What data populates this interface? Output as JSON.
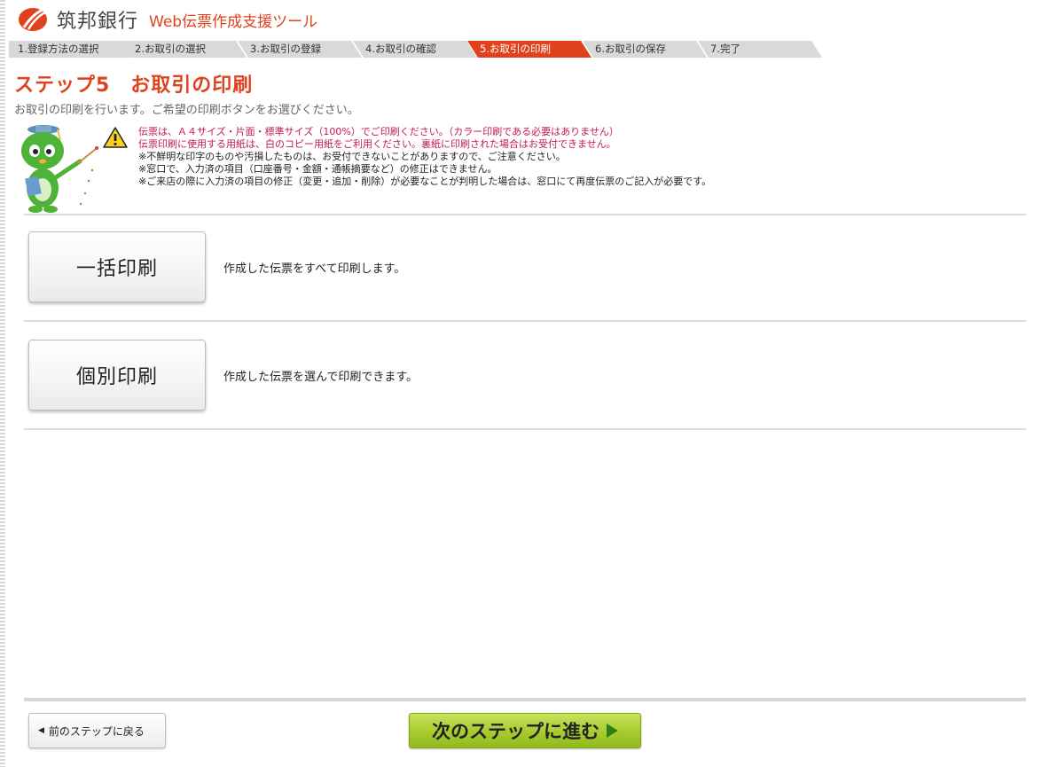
{
  "header": {
    "bank_name": "筑邦銀行",
    "tool_name": "Web伝票作成支援ツール",
    "brand_color": "#e0421d"
  },
  "steps": [
    {
      "label": "1.登録方法の選択",
      "active": false
    },
    {
      "label": "2.お取引の選択",
      "active": false
    },
    {
      "label": "3.お取引の登録",
      "active": false
    },
    {
      "label": "4.お取引の確認",
      "active": false
    },
    {
      "label": "5.お取引の印刷",
      "active": true
    },
    {
      "label": "6.お取引の保存",
      "active": false
    },
    {
      "label": "7.完了",
      "active": false
    }
  ],
  "page": {
    "title": "ステップ5　お取引の印刷",
    "subtitle": "お取引の印刷を行います。ご希望の印刷ボタンをお選びください。"
  },
  "notes": [
    "伝票は、Ａ４サイズ・片面・標準サイズ（100%）でご印刷ください。（カラー印刷である必要はありません）",
    "伝票印刷に使用する用紙は、白のコピー用紙をご利用ください。裏紙に印刷された場合はお受付できません。",
    "※不鮮明な印字のものや汚損したものは、お受付できないことがありますので、ご注意ください。",
    "※窓口で、入力済の項目（口座番号・金額・通帳摘要など）の修正はできません。",
    "※ご来店の際に入力済の項目の修正（変更・追加・削除）が必要なことが判明した場合は、窓口にて再度伝票のご記入が必要です。"
  ],
  "print_options": [
    {
      "label": "一括印刷",
      "description": "作成した伝票をすべて印刷します。"
    },
    {
      "label": "個別印刷",
      "description": "作成した伝票を選んで印刷できます。"
    }
  ],
  "footer": {
    "back_label": "前のステップに戻る",
    "next_label": "次のステップに進む"
  }
}
